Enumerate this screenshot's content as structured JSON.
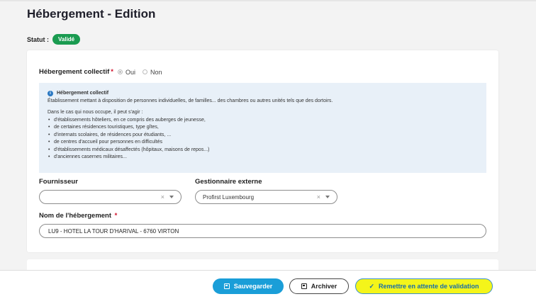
{
  "page": {
    "title": "Hébergement - Edition"
  },
  "status": {
    "label": "Statut :",
    "badge": "Validé",
    "badge_color": "#1a9b50"
  },
  "collectif": {
    "label": "Hébergement collectif",
    "required_mark": "*",
    "options": [
      "Oui",
      "Non"
    ],
    "selected": "Oui"
  },
  "info": {
    "icon": "info-icon",
    "title": "Hébergement collectif",
    "description": "Établissement mettant à disposition de personnes individuelles, de familles... des chambres ou autres unités tels que des dortoirs.",
    "intro": "Dans le cas qui nous occupe, il peut s'agir :",
    "items": [
      "d'établissements hôteliers, en ce compris des auberges de jeunesse,",
      "de certaines résidences touristiques, type gîtes,",
      "d'internats scolaires, de résidences pour étudiants, ...",
      "de centres d'accueil pour personnes en difficultés",
      "d'établissements médicaux désaffectés (hôpitaux, maisons de repos...)",
      "d'anciennes casernes militaires..."
    ]
  },
  "fournisseur": {
    "label": "Fournisseur",
    "value": ""
  },
  "gestionnaire": {
    "label": "Gestionnaire externe",
    "value": "Profirst Luxembourg"
  },
  "nom": {
    "label": "Nom de l'hébergement",
    "required_mark": "*",
    "value": "LU9 - HOTEL LA TOUR D'HARIVAL - 6760 VIRTON"
  },
  "footer": {
    "save_label": "Sauvegarder",
    "archive_label": "Archiver",
    "revalidate_label": "Remettre en attente de validation",
    "save_color": "#1a9ed8",
    "highlight_color": "#f4f51a"
  }
}
